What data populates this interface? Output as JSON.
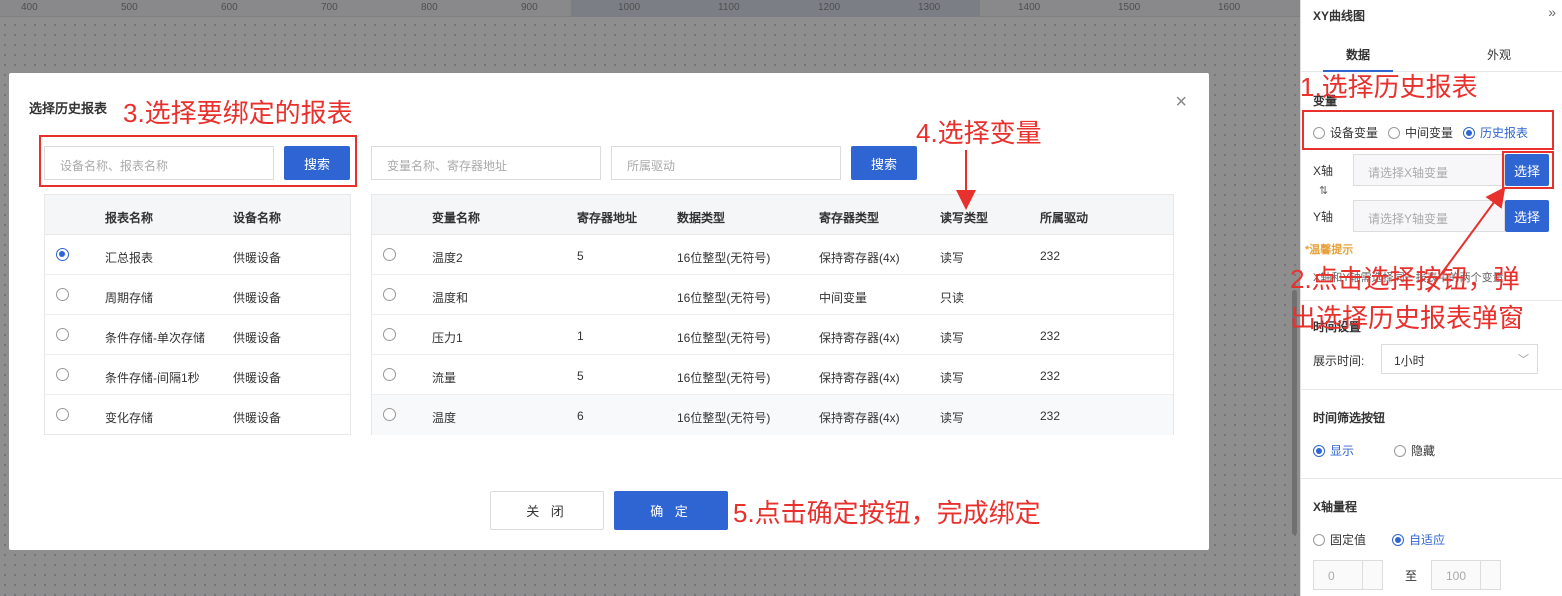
{
  "ruler": {
    "ticks": [
      "400",
      "500",
      "600",
      "700",
      "800",
      "900",
      "1000",
      "1100",
      "1200",
      "1300",
      "1400",
      "1500",
      "1600"
    ]
  },
  "panel": {
    "title": "XY曲线图",
    "collapse_icon": "»",
    "tabs": [
      {
        "label": "数据"
      },
      {
        "label": "外观"
      }
    ],
    "variable_section": {
      "title": "变量",
      "options": [
        {
          "label": "设备变量"
        },
        {
          "label": "中间变量"
        },
        {
          "label": "历史报表"
        }
      ],
      "selected": "历史报表",
      "x_axis": {
        "label": "X轴",
        "placeholder": "请选择X轴变量",
        "button": "选择"
      },
      "swap_icon": "⇅",
      "y_axis": {
        "label": "Y轴",
        "placeholder": "请选择Y轴变量",
        "button": "选择"
      }
    },
    "tip": {
      "title": "*温馨提示",
      "text": "X轴和Y轴需选择同一报表中的两个变量"
    },
    "time_section": {
      "title": "时间设置",
      "label": "展示时间:",
      "value": "1小时"
    },
    "filter_section": {
      "title": "时间筛选按钮",
      "options": [
        {
          "label": "显示"
        },
        {
          "label": "隐藏"
        }
      ],
      "selected": "显示"
    },
    "range_section": {
      "title": "X轴量程",
      "options": [
        {
          "label": "固定值"
        },
        {
          "label": "自适应"
        }
      ],
      "selected": "自适应",
      "min": "0",
      "to": "至",
      "max": "100"
    }
  },
  "modal": {
    "title": "选择历史报表",
    "close_icon": "×",
    "report_search": {
      "placeholder": "设备名称、报表名称",
      "button": "搜索"
    },
    "var_search": {
      "placeholder1": "变量名称、寄存器地址",
      "placeholder2": "所属驱动",
      "button": "搜索"
    },
    "report_table": {
      "columns": [
        "报表名称",
        "设备名称"
      ],
      "rows": [
        {
          "name": "汇总报表",
          "device": "供暖设备",
          "selected": true
        },
        {
          "name": "周期存储",
          "device": "供暖设备",
          "selected": false
        },
        {
          "name": "条件存储-单次存储",
          "device": "供暖设备",
          "selected": false
        },
        {
          "name": "条件存储-间隔1秒",
          "device": "供暖设备",
          "selected": false
        },
        {
          "name": "变化存储",
          "device": "供暖设备",
          "selected": false
        }
      ]
    },
    "var_table": {
      "columns": [
        "变量名称",
        "寄存器地址",
        "数据类型",
        "寄存器类型",
        "读写类型",
        "所属驱动"
      ],
      "rows": [
        {
          "name": "温度2",
          "addr": "5",
          "dtype": "16位整型(无符号)",
          "rtype": "保持寄存器(4x)",
          "rw": "读写",
          "driver": "232"
        },
        {
          "name": "温度和",
          "addr": "",
          "dtype": "16位整型(无符号)",
          "rtype": "中间变量",
          "rw": "只读",
          "driver": ""
        },
        {
          "name": "压力1",
          "addr": "1",
          "dtype": "16位整型(无符号)",
          "rtype": "保持寄存器(4x)",
          "rw": "读写",
          "driver": "232"
        },
        {
          "name": "流量",
          "addr": "5",
          "dtype": "16位整型(无符号)",
          "rtype": "保持寄存器(4x)",
          "rw": "读写",
          "driver": "232"
        },
        {
          "name": "温度",
          "addr": "6",
          "dtype": "16位整型(无符号)",
          "rtype": "保持寄存器(4x)",
          "rw": "读写",
          "driver": "232"
        }
      ]
    },
    "close_button": "关 闭",
    "ok_button": "确 定"
  },
  "annotations": {
    "step1": "1.选择历史报表",
    "step2_line1": "2.点击选择按钮，弹",
    "step2_line2": "出选择历史报表弹窗",
    "step3": "3.选择要绑定的报表",
    "step4": "4.选择变量",
    "step5": "5.点击确定按钮，完成绑定",
    "color": "#e8302d"
  },
  "colors": {
    "primary": "#2f65d2",
    "annotation": "#e8302d",
    "tip": "#e6a23c"
  }
}
